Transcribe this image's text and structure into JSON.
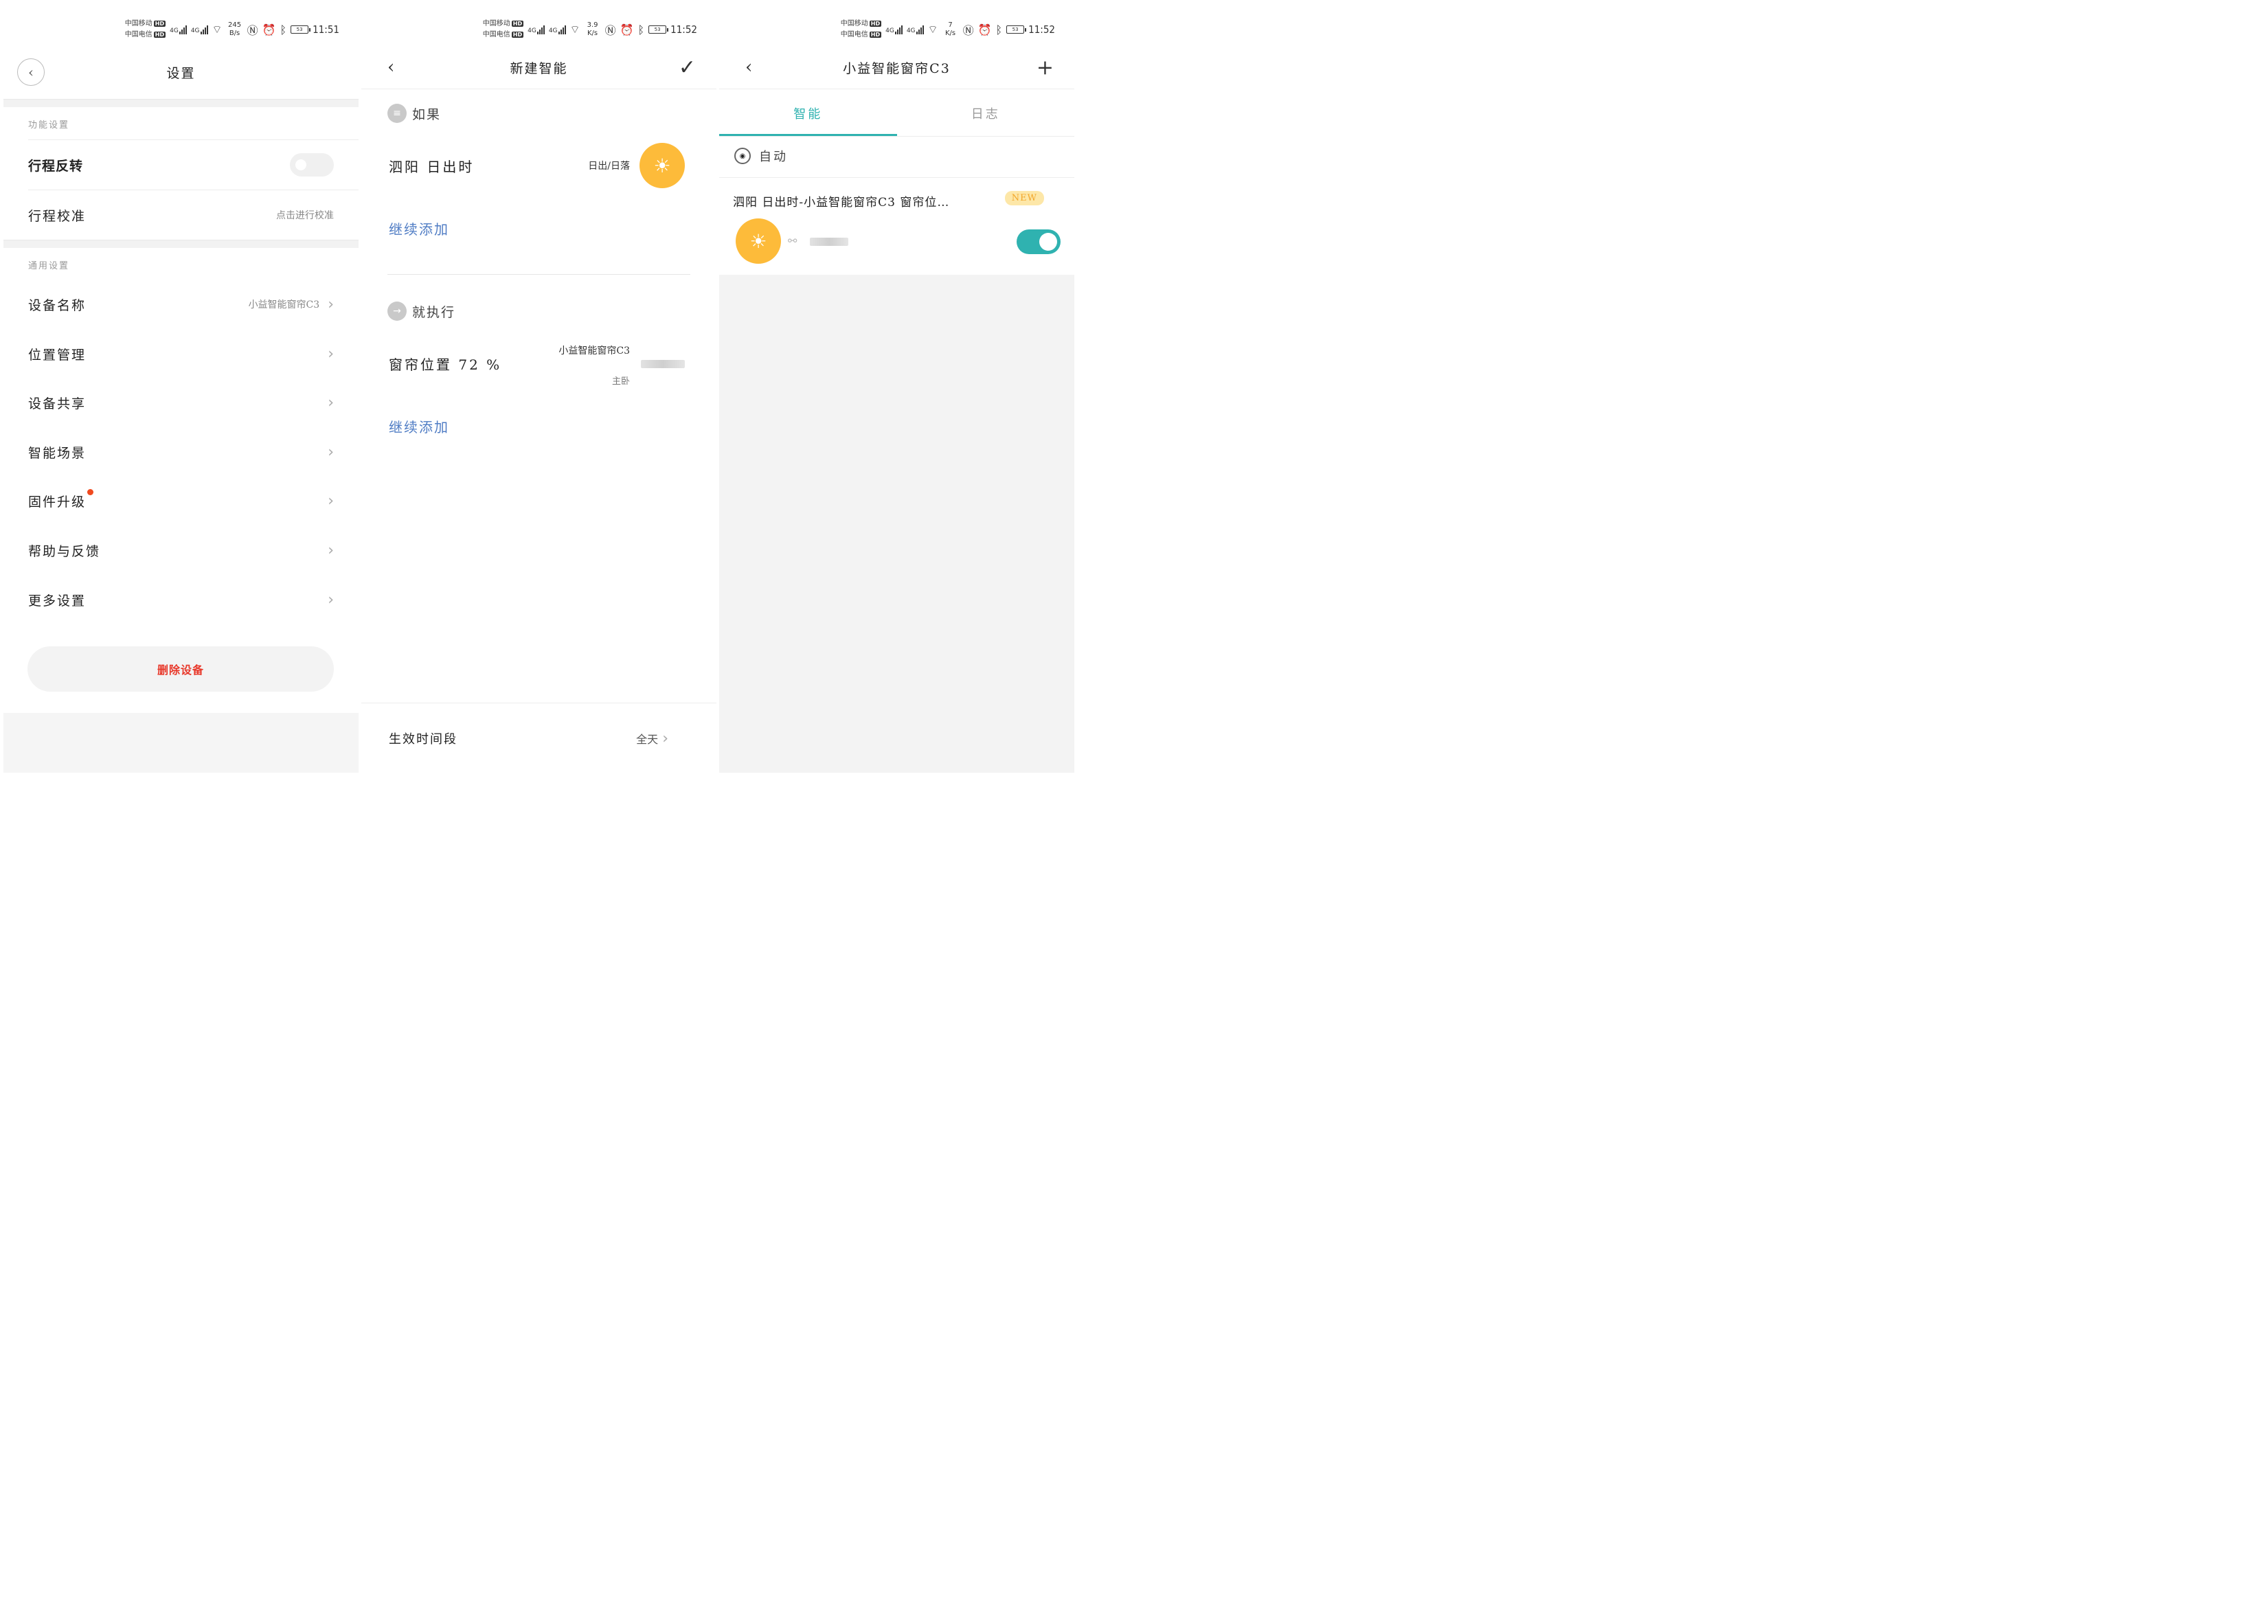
{
  "status_bars": [
    {
      "carrier1": "中国移动",
      "carrier2": "中国电信",
      "hd": "HD",
      "net": "4G",
      "speed_num": "245",
      "speed_unit": "B/s",
      "battery": "53",
      "time": "11:51"
    },
    {
      "carrier1": "中国移动",
      "carrier2": "中国电信",
      "hd": "HD",
      "net": "4G",
      "speed_num": "3.9",
      "speed_unit": "K/s",
      "battery": "53",
      "time": "11:52"
    },
    {
      "carrier1": "中国移动",
      "carrier2": "中国电信",
      "hd": "HD",
      "net": "4G",
      "speed_num": "7",
      "speed_unit": "K/s",
      "battery": "53",
      "time": "11:52"
    }
  ],
  "settings": {
    "title": "设置",
    "section_function": "功能设置",
    "travel_reverse": "行程反转",
    "travel_reverse_on": false,
    "travel_calibrate": "行程校准",
    "travel_calibrate_hint": "点击进行校准",
    "section_general": "通用设置",
    "items": [
      {
        "label": "设备名称",
        "value": "小益智能窗帘C3"
      },
      {
        "label": "位置管理",
        "value": ""
      },
      {
        "label": "设备共享",
        "value": ""
      },
      {
        "label": "智能场景",
        "value": ""
      },
      {
        "label": "固件升级",
        "value": ""
      },
      {
        "label": "帮助与反馈",
        "value": ""
      },
      {
        "label": "更多设置",
        "value": ""
      }
    ],
    "delete_button": "删除设备"
  },
  "new_smart": {
    "title": "新建智能",
    "if_label": "如果",
    "condition_text": "泗阳 日出时",
    "condition_sub": "日出/日落",
    "continue_add_1": "继续添加",
    "then_label": "就执行",
    "action_text": "窗帘位置 72 %",
    "action_device": "小益智能窗帘C3",
    "action_room": "主卧",
    "continue_add_2": "继续添加",
    "effective_period_label": "生效时间段",
    "effective_period_value": "全天"
  },
  "device_smart": {
    "title": "小益智能窗帘C3",
    "tabs": [
      "智能",
      "日志"
    ],
    "active_tab": 0,
    "group_label": "自动",
    "card_title": "泗阳 日出时-小益智能窗帘C3 窗帘位…",
    "badge": "NEW",
    "card_enabled": true
  },
  "colors": {
    "accent_teal": "#2fb2b0",
    "sun_orange": "#fdbb3a",
    "delete_red": "#e8382a",
    "link_blue": "#4f7cc4",
    "new_badge_bg": "#fde7a8"
  },
  "icons": {
    "back": "chevron-left-icon",
    "confirm": "checkmark-icon",
    "add": "plus-icon",
    "sun": "sunrise-icon",
    "list": "list-icon",
    "arrow": "arrow-right-icon",
    "robot": "robot-icon",
    "link": "link-icon"
  }
}
